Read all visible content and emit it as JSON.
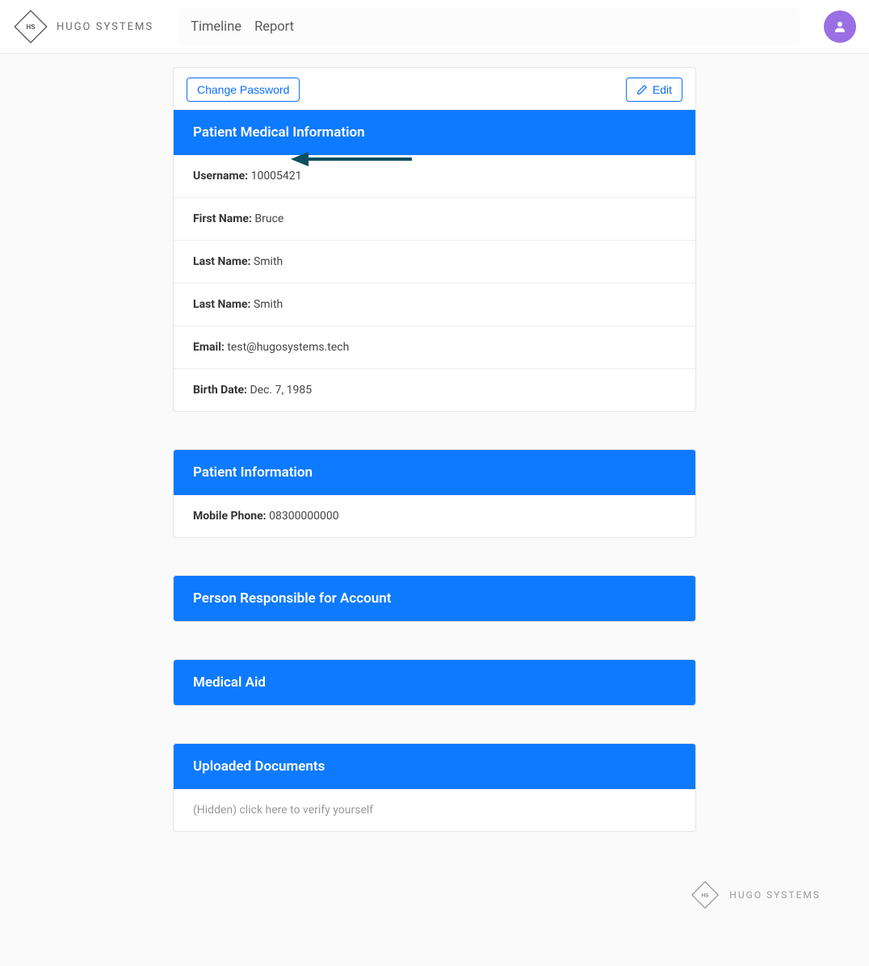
{
  "brand": {
    "logo_text_hs": "HS",
    "name": "HUGO SYSTEMS"
  },
  "nav": {
    "timeline": "Timeline",
    "report": "Report"
  },
  "buttons": {
    "change_password": "Change Password",
    "edit": "Edit"
  },
  "sections": {
    "medical": {
      "title": "Patient Medical Information",
      "fields": {
        "username_label": "Username:",
        "username_value": "10005421",
        "first_name_label": "First Name:",
        "first_name_value": "Bruce",
        "last_name_label": "Last Name:",
        "last_name_value": "Smith",
        "last_name_label2": "Last Name:",
        "last_name_value2": "Smith",
        "email_label": "Email:",
        "email_value": "test@hugosystems.tech",
        "birth_date_label": "Birth Date:",
        "birth_date_value": "Dec. 7, 1985"
      }
    },
    "patient_info": {
      "title": "Patient Information",
      "fields": {
        "mobile_label": "Mobile Phone:",
        "mobile_value": "08300000000"
      }
    },
    "responsible": {
      "title": "Person Responsible for Account"
    },
    "medical_aid": {
      "title": "Medical Aid"
    },
    "documents": {
      "title": "Uploaded Documents",
      "hidden_text": "(Hidden) click here to verify yourself"
    }
  },
  "footer": {
    "name": "HUGO SYSTEMS"
  },
  "colors": {
    "primary": "#0d7aff",
    "outline": "#0d6efd",
    "arrow": "#0b4f5f",
    "avatar": "#9a6fe3"
  }
}
